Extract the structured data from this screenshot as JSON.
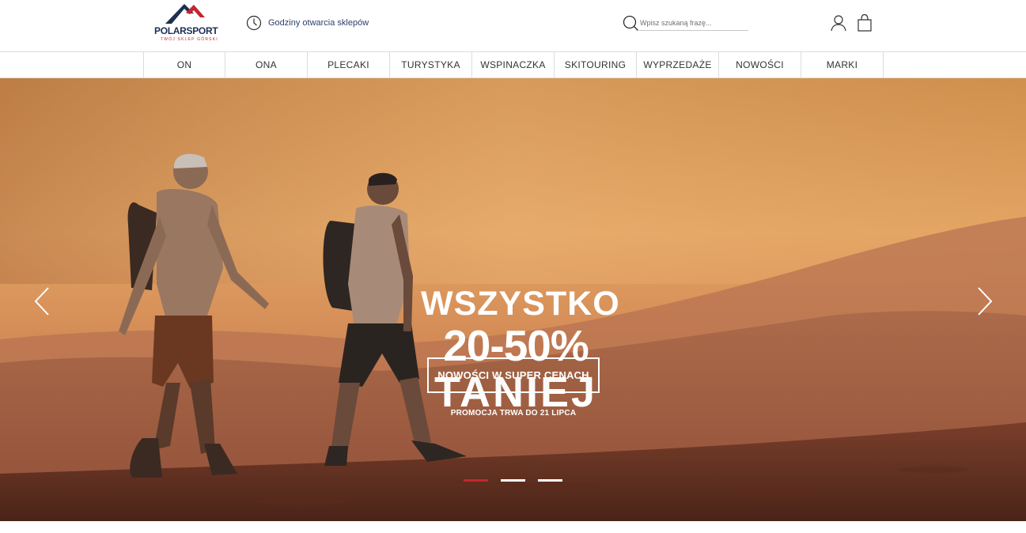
{
  "brand": {
    "name_part1": "POLAR",
    "name_part2": "SPORT",
    "tagline": "TWÓJ SKLEP GÓRSKI",
    "colors": {
      "navy": "#1d2f55",
      "red": "#c4262e"
    }
  },
  "header": {
    "hours_label": "Godziny otwarcia sklepów",
    "hours_icon": "clock-icon",
    "search_placeholder": "Wpisz szukaną frazę...",
    "search_icon": "search-icon",
    "account_icon": "user-icon",
    "cart_icon": "shopping-bag-icon"
  },
  "nav": {
    "items": [
      "ON",
      "ONA",
      "PLECAKI",
      "TURYSTYKA",
      "WSPINACZKA",
      "SKITOURING",
      "WYPRZEDAŻE",
      "NOWOŚCI",
      "MARKI"
    ]
  },
  "hero": {
    "headline_1": "WSZYSTKO",
    "headline_2": "20-50%",
    "headline_3": "TANIEJ",
    "cta_label": "NOWOŚCI W SUPER CENACH",
    "promo_text": "PROMOCJA TRWA DO 21 LIPCA",
    "prev_icon": "chevron-left-icon",
    "next_icon": "chevron-right-icon",
    "slides_total": 3,
    "active_slide": 1,
    "active_dot_color": "#c4262e"
  }
}
